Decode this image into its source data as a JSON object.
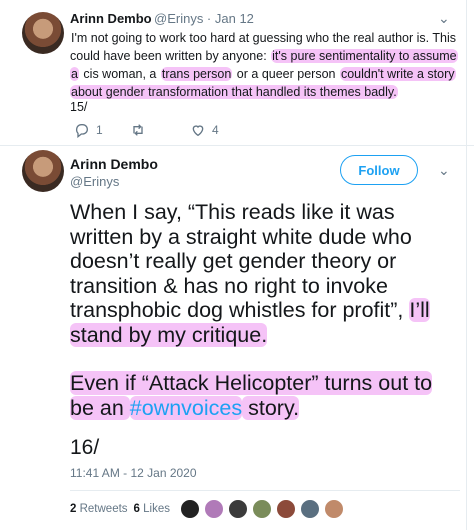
{
  "tweet1": {
    "name": "Arinn Dembo",
    "meta": "@Erinys · Jan 12",
    "text_plain_1": "I'm not going to work too hard at guessing who the real author is. This could have been written by anyone: ",
    "text_hl_1": "it's pure sentimentality to assume a",
    "text_plain_2": " cis woman, a ",
    "text_hl_2": "trans person",
    "text_plain_3": " or a queer person ",
    "text_hl_3": "couldn't write a story about gender transformation that handled its themes badly.",
    "number": "15/",
    "replies": "1",
    "likes": "4"
  },
  "tweet2": {
    "name": "Arinn Dembo",
    "handle": "@Erinys",
    "follow_label": "Follow",
    "para1_plain": "When I say, “This reads like it was written by a straight white dude who doesn’t really get gender theory or transition & has no right to invoke transphobic dog whistles for profit”, ",
    "para1_hl": "I’ll stand by my critique.",
    "para2_hl_a": "Even if “Attack Helicopter” turns out to be an ",
    "para2_hashtag": "#ownvoices",
    "para2_hl_b": " story.",
    "number": "16/",
    "timestamp": "11:41 AM - 12 Jan 2020",
    "retweets_count": "2",
    "retweets_label": "Retweets",
    "likes_count": "6",
    "likes_label": "Likes"
  },
  "icons": [
    "reply-icon",
    "retweet-icon",
    "like-icon",
    "chevron-down-icon"
  ],
  "colors": {
    "accent": "#1da1f2",
    "highlight": "#f5c3f7",
    "muted": "#657786"
  }
}
